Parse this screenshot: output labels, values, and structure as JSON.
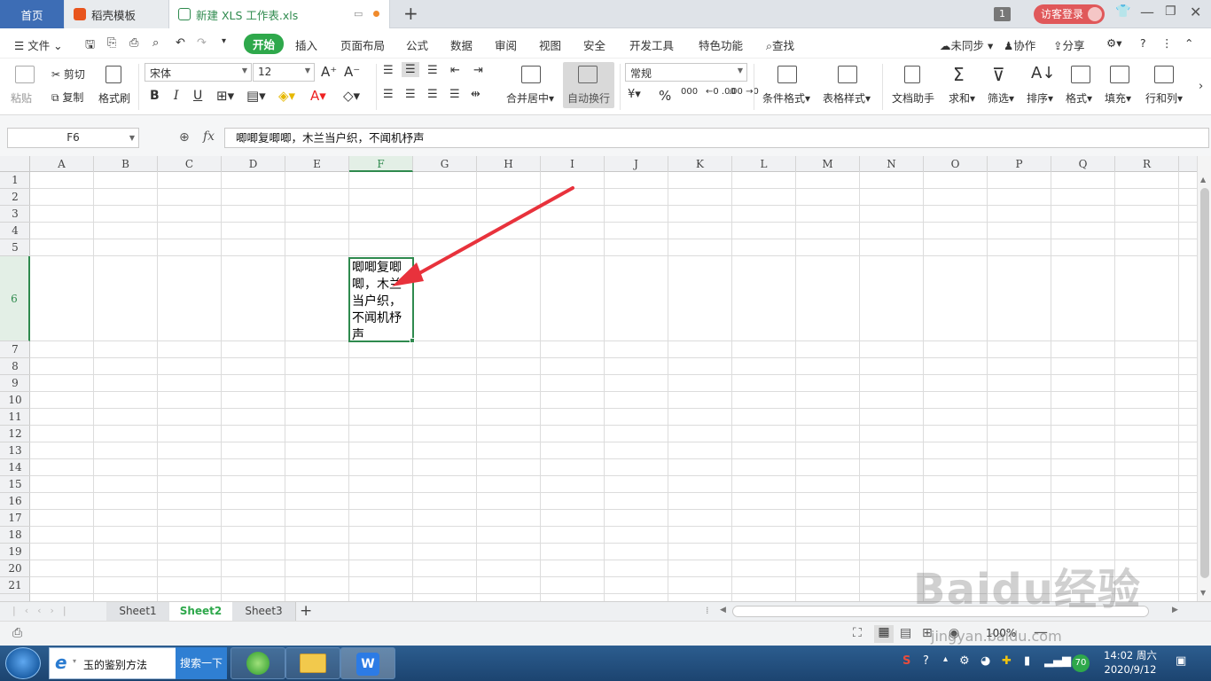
{
  "tabs": {
    "home": "首页",
    "template": "稻壳模板",
    "file": "新建 XLS 工作表.xls",
    "counter": "1",
    "login": "访客登录"
  },
  "menu": {
    "file": "文件",
    "start": "开始",
    "insert": "插入",
    "layout": "页面布局",
    "formula": "公式",
    "data": "数据",
    "review": "审阅",
    "view": "视图",
    "security": "安全",
    "dev": "开发工具",
    "special": "特色功能",
    "find": "查找",
    "sync": "未同步",
    "collab": "协作",
    "share": "分享"
  },
  "ribbon": {
    "paste": "粘贴",
    "cut": "剪切",
    "copy": "复制",
    "format_painter": "格式刷",
    "font_name": "宋体",
    "font_size": "12",
    "merge": "合并居中",
    "wrap": "自动换行",
    "number_format": "常规",
    "cond_format": "条件格式",
    "table_style": "表格样式",
    "doc_helper": "文档助手",
    "sum": "求和",
    "filter": "筛选",
    "sort": "排序",
    "format": "格式",
    "fill": "填充",
    "rowcol": "行和列"
  },
  "formula_bar": {
    "name_box": "F6",
    "fx": "fx",
    "content": "唧唧复唧唧，木兰当户织，不闻机杼声"
  },
  "grid": {
    "columns": [
      "A",
      "B",
      "C",
      "D",
      "E",
      "F",
      "G",
      "H",
      "I",
      "J",
      "K",
      "L",
      "M",
      "N",
      "O",
      "P",
      "Q",
      "R"
    ],
    "rows": [
      "1",
      "2",
      "3",
      "4",
      "5",
      "6",
      "7",
      "8",
      "9",
      "10",
      "11",
      "12",
      "13",
      "14",
      "15",
      "16",
      "17",
      "18",
      "19",
      "20",
      "21"
    ],
    "active_cell_text": "唧唧复唧唧，木兰当户织，不闻机杼声"
  },
  "sheets": [
    "Sheet1",
    "Sheet2",
    "Sheet3"
  ],
  "active_sheet": "Sheet2",
  "status": {
    "zoom": "100%"
  },
  "taskbar": {
    "search_text": "玉的鉴别方法",
    "search_button": "搜索一下",
    "time": "14:02 周六",
    "date": "2020/9/12",
    "badge": "70"
  },
  "watermark": {
    "logo": "Baidu经验",
    "url": "jingyan.baidu.com"
  },
  "colors": {
    "accent": "#2ea84b",
    "tab_active": "#3d6db5",
    "arrow": "#e8323c"
  }
}
